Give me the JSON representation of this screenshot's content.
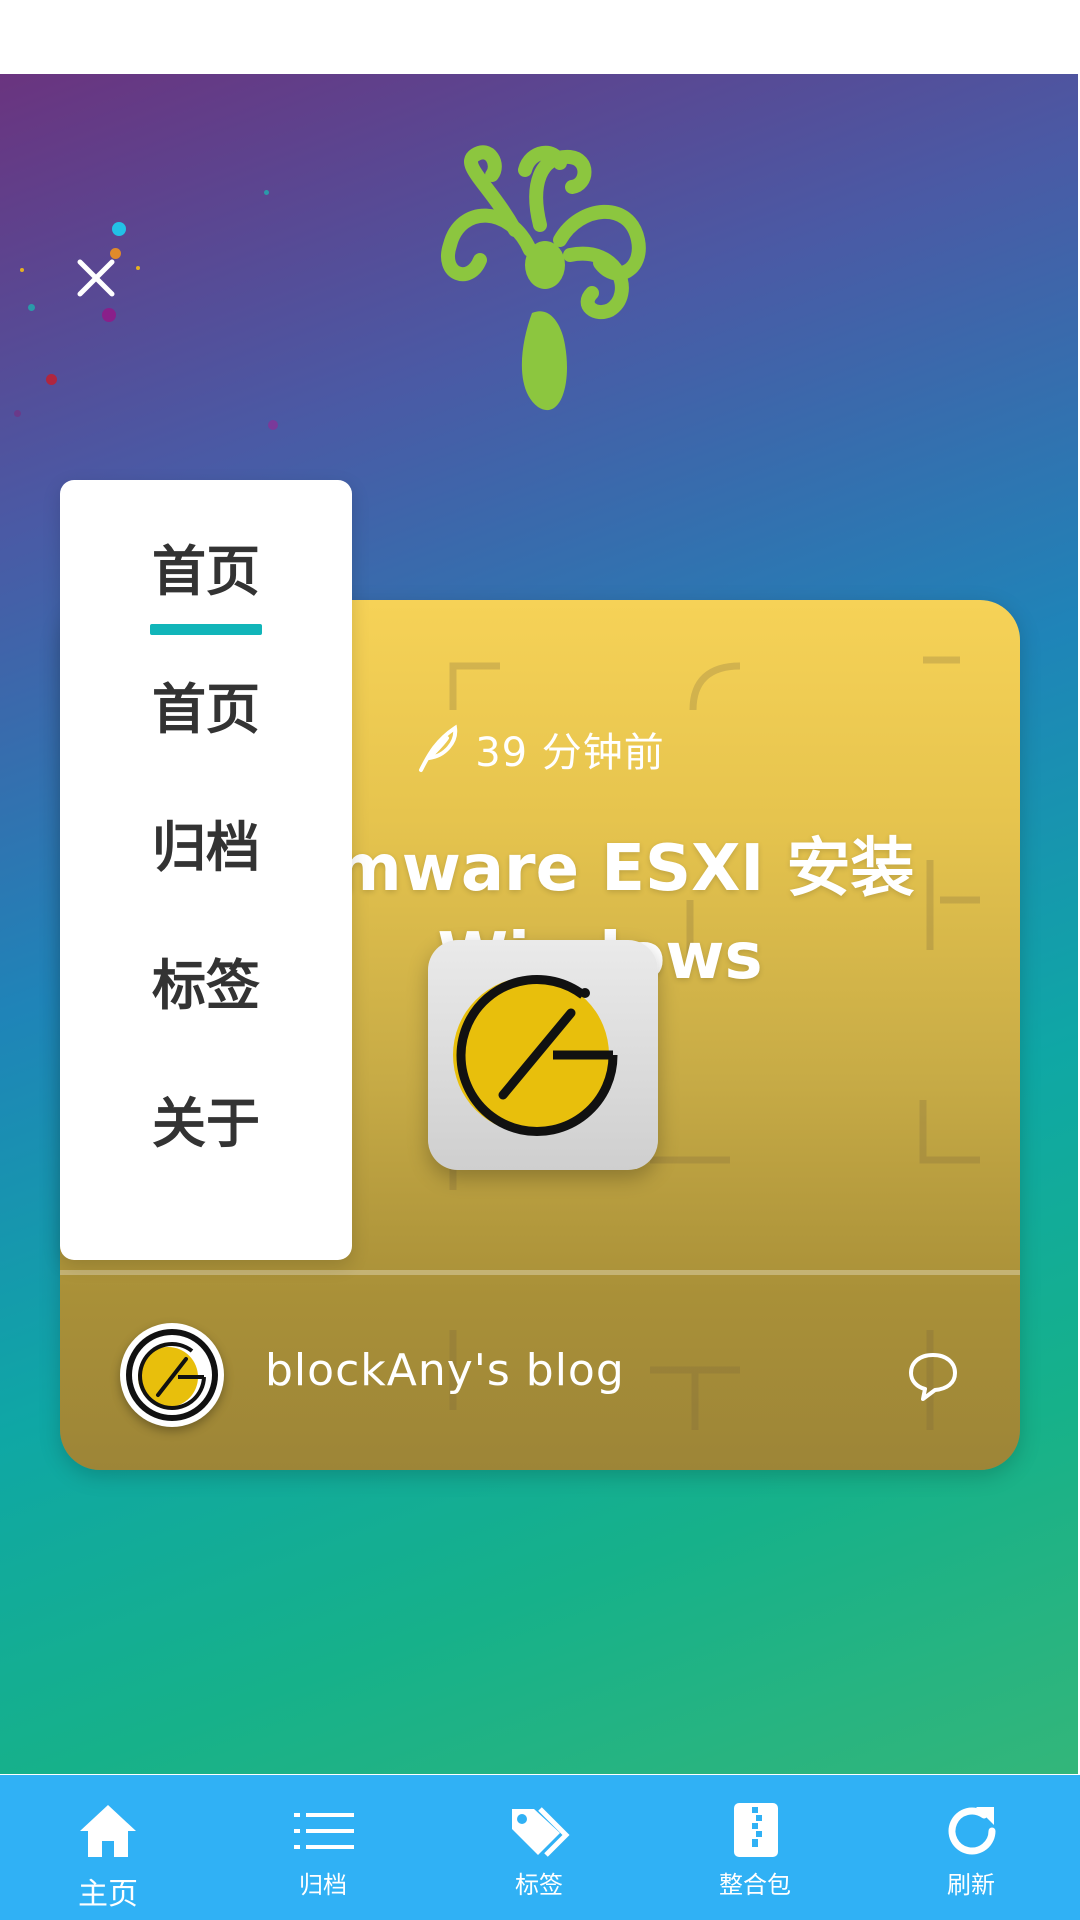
{
  "header": {
    "close_icon": "close-icon",
    "logo_icon": "tree-logo-icon"
  },
  "menu": {
    "items": [
      {
        "label": "首页"
      },
      {
        "label": "首页"
      },
      {
        "label": "归档"
      },
      {
        "label": "标签"
      },
      {
        "label": "关于"
      }
    ]
  },
  "post": {
    "time_ago": "39 分钟前",
    "title_line1": "Vmware ESXI 安装",
    "title_line2": "Windows",
    "author": "blockAny's blog",
    "time_icon": "feather-icon",
    "comment_icon": "comment-icon"
  },
  "bottom_nav": {
    "items": [
      {
        "label": "主页",
        "icon": "home-icon"
      },
      {
        "label": "归档",
        "icon": "list-icon"
      },
      {
        "label": "标签",
        "icon": "tags-icon"
      },
      {
        "label": "整合包",
        "icon": "zip-file-icon"
      },
      {
        "label": "刷新",
        "icon": "refresh-icon"
      }
    ]
  },
  "colors": {
    "nav_background": "#30b1f5",
    "menu_underline": "#11b5b9",
    "card_top": "#f6d257",
    "card_bottom": "#9d8537"
  }
}
